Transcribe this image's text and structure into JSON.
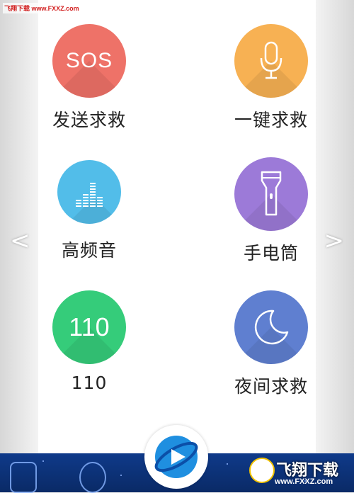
{
  "watermark_top": "飞翔下载 www.FXXZ.com",
  "nav": {
    "prev": "<",
    "next": ">"
  },
  "grid": [
    {
      "id": "sos",
      "icon_text": "SOS",
      "label": "发送求救",
      "color": "#ee7268",
      "icon": "sos-icon"
    },
    {
      "id": "voice",
      "icon_text": "",
      "label": "一键求救",
      "color": "#f7b153",
      "icon": "microphone-icon"
    },
    {
      "id": "tone",
      "icon_text": "",
      "label": "高频音",
      "color": "#52bde9",
      "icon": "equalizer-icon"
    },
    {
      "id": "torch",
      "icon_text": "",
      "label": "手电筒",
      "color": "#9c7ad8",
      "icon": "flashlight-icon"
    },
    {
      "id": "police",
      "icon_text": "110",
      "label": "110",
      "color": "#35cc7a",
      "icon": "number-icon"
    },
    {
      "id": "night",
      "icon_text": "",
      "label": "夜间求救",
      "color": "#5f7fd0",
      "icon": "moon-icon"
    }
  ],
  "brand": {
    "name": "飞翔下载",
    "url": "www.FXXZ.com"
  }
}
